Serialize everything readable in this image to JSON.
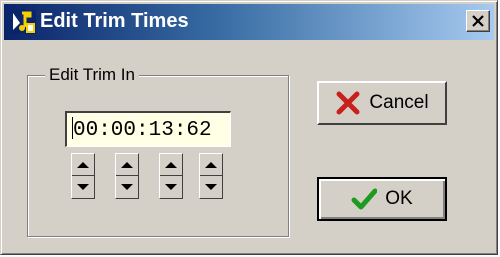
{
  "window": {
    "title": "Edit Trim Times",
    "close_glyph": "✕",
    "accent": "#0a246a"
  },
  "group": {
    "label": "Edit Trim In"
  },
  "time_input": {
    "value": "00:00:13:62"
  },
  "spinners": [
    {
      "icon_up": "arrow-up-icon",
      "icon_down": "arrow-down-icon"
    },
    {
      "icon_up": "arrow-up-icon",
      "icon_down": "arrow-down-icon"
    },
    {
      "icon_up": "arrow-up-icon",
      "icon_down": "arrow-down-icon"
    },
    {
      "icon_up": "arrow-up-icon",
      "icon_down": "arrow-down-icon"
    }
  ],
  "buttons": {
    "cancel_label": "Cancel",
    "cancel_icon": "red-x-icon",
    "ok_label": "OK",
    "ok_icon": "green-check-icon"
  }
}
